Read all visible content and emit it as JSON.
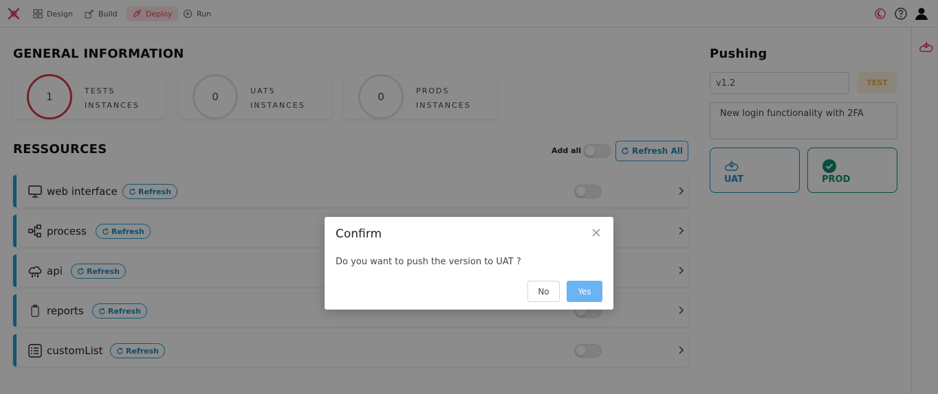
{
  "nav": {
    "items": [
      {
        "label": "Design",
        "icon": "grid-icon"
      },
      {
        "label": "Build",
        "icon": "build-icon"
      },
      {
        "label": "Deploy",
        "icon": "rocket-icon"
      },
      {
        "label": "Run",
        "icon": "run-icon"
      }
    ],
    "active": "Deploy"
  },
  "general": {
    "title": "GENERAL INFORMATION",
    "stats": [
      {
        "value": "1",
        "line1": "TESTS",
        "line2": "INSTANCES"
      },
      {
        "value": "0",
        "line1": "UATS",
        "line2": "INSTANCES"
      },
      {
        "value": "0",
        "line1": "PRODS",
        "line2": "INSTANCES"
      }
    ]
  },
  "resources": {
    "title": "RESSOURCES",
    "add_all_label": "Add all",
    "refresh_all_label": "Refresh All",
    "refresh_label": "Refresh",
    "items": [
      {
        "name": "web interface",
        "icon": "monitor-icon"
      },
      {
        "name": "process",
        "icon": "process-icon"
      },
      {
        "name": "api",
        "icon": "cloud-api-icon"
      },
      {
        "name": "reports",
        "icon": "clipboard-icon"
      },
      {
        "name": "customList",
        "icon": "list-icon"
      }
    ]
  },
  "pushing": {
    "title": "Pushing",
    "version": "v1.2",
    "env_badge": "TEST",
    "description": "New login functionality with 2FA",
    "uat_label": "UAT",
    "prod_label": "PROD"
  },
  "modal": {
    "title": "Confirm",
    "message": "Do you want to push the version to UAT ?",
    "no_label": "No",
    "yes_label": "Yes"
  },
  "colors": {
    "accent_red": "#e03e52",
    "accent_blue": "#1d9fd0",
    "prod_green": "#0a8f6f",
    "uat_blue": "#1a8fc0"
  }
}
